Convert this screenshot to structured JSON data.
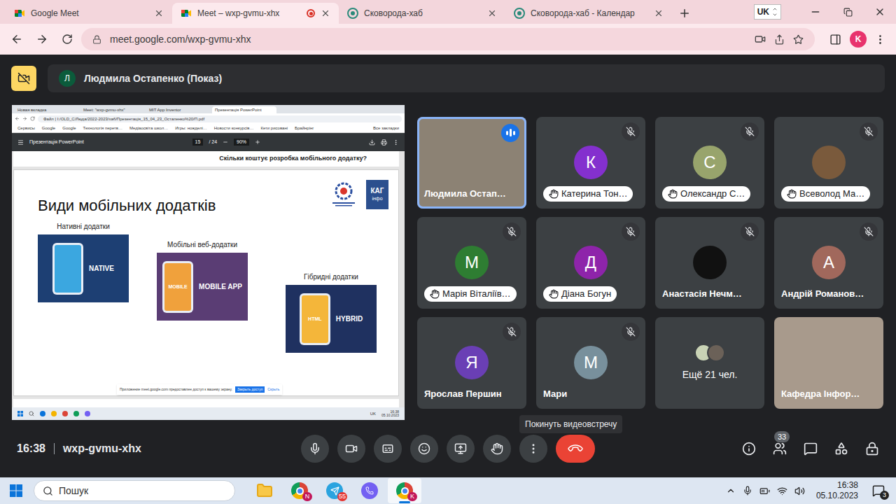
{
  "browser": {
    "tabs": [
      {
        "label": "Google Meet",
        "selected": false,
        "recording": false,
        "kind": "meet"
      },
      {
        "label": "Meet – wxp-gvmu-xhx",
        "selected": true,
        "recording": true,
        "kind": "meet"
      },
      {
        "label": "Сковорода-хаб",
        "selected": false,
        "recording": false,
        "kind": "hub"
      },
      {
        "label": "Сковорода-хаб - Календар",
        "selected": false,
        "recording": false,
        "kind": "hub"
      }
    ],
    "language": "UK",
    "url": "meet.google.com/wxp-gvmu-xhx",
    "profile": "K"
  },
  "meet": {
    "presenter": {
      "initial": "Л",
      "label": "Людмила Остапенко (Показ)"
    },
    "screen": {
      "tabs": [
        {
          "label": "Новая вкладка",
          "selected": false
        },
        {
          "label": "Meet: \"wxp-gvmu-xhx\"",
          "selected": false
        },
        {
          "label": "MIT App Inventor",
          "selected": false
        },
        {
          "label": "Презентація PowerPoint",
          "selected": true
        }
      ],
      "url": "Файл | I:/OLD_C/Люда/2022-2023/хаб/Презентація_15_04_23_Остапенко%20/П.pdf",
      "bookmarks": [
        "Сервисы",
        "Google",
        "Google",
        "Технологія перетв…",
        "Медіаосвіта школ…",
        "Игры: ножделі…",
        "Новости конкурсів…",
        "Кети рисовані",
        "Брайнрінг"
      ],
      "all_bookmarks": "Все закладки",
      "pdf_title": "Презентація PowerPoint",
      "page": "15",
      "pages": "/ 24",
      "zoom": "90%",
      "prev_heading": "Скільки коштує розробка мобільного додатку?",
      "slide_title": "Види мобільних додатків",
      "logo": "КАГ",
      "logo_sub": "інфо",
      "app_types": [
        {
          "label": "Нативні додатки",
          "badge": "NATIVE",
          "screen_text": "",
          "color": "#1d3f73"
        },
        {
          "label": "Мобільні веб-додатки",
          "badge": "MOBILE APP",
          "screen_text": "MOBILE",
          "color": "#5a3d74"
        },
        {
          "label": "Гібридні додатки",
          "badge": "HYBRID",
          "screen_text": "HTML",
          "color": "#1f3160"
        }
      ],
      "banner": {
        "text": "Приложение meet.google.com предоставлен доступ к вашему экрану.",
        "button": "Закрыть доступ",
        "link": "Скрыть"
      },
      "taskbar": {
        "lang": "UK",
        "time": "16:38",
        "date": "05.10.2023"
      }
    },
    "participants": [
      {
        "kind": "video",
        "name": "Людмила Остап…",
        "initial": "",
        "color": "#8c8274",
        "muted": false,
        "hand_raised": false,
        "speaking": true
      },
      {
        "kind": "avatar",
        "name": "Катерина Тон…",
        "initial": "К",
        "color": "#8430ce",
        "muted": true,
        "hand_raised": true,
        "speaking": false
      },
      {
        "kind": "avatar",
        "name": "Олександр С…",
        "initial": "С",
        "color": "#98a46c",
        "muted": true,
        "hand_raised": true,
        "speaking": false
      },
      {
        "kind": "photo",
        "name": "Всеволод Ма…",
        "initial": "",
        "color": "#7a5a3c",
        "muted": true,
        "hand_raised": true,
        "speaking": false
      },
      {
        "kind": "avatar",
        "name": "Марія Віталіїв…",
        "initial": "М",
        "color": "#2e7d32",
        "muted": true,
        "hand_raised": true,
        "speaking": false
      },
      {
        "kind": "avatar",
        "name": "Діана Богун",
        "initial": "Д",
        "color": "#8e24aa",
        "muted": true,
        "hand_raised": true,
        "speaking": false
      },
      {
        "kind": "photo",
        "name": "Анастасія Нечм…",
        "initial": "",
        "color": "#111111",
        "muted": true,
        "hand_raised": false,
        "speaking": false
      },
      {
        "kind": "avatar",
        "name": "Андрій Романов…",
        "initial": "А",
        "color": "#a1685c",
        "muted": true,
        "hand_raised": false,
        "speaking": false
      },
      {
        "kind": "avatar",
        "name": "Ярослав Першин",
        "initial": "Я",
        "color": "#6a3fb5",
        "muted": true,
        "hand_raised": false,
        "speaking": false
      },
      {
        "kind": "avatar",
        "name": "Мари",
        "initial": "М",
        "color": "#78909c",
        "muted": true,
        "hand_raised": false,
        "speaking": false
      },
      {
        "kind": "more",
        "name": "Ещё 21 чел.",
        "initial": "",
        "color": "#3c4043",
        "muted": false,
        "hand_raised": false,
        "speaking": false
      },
      {
        "kind": "video",
        "name": "Кафедра Інфор…",
        "initial": "",
        "color": "#a89a8c",
        "muted": false,
        "hand_raised": false,
        "speaking": false
      }
    ],
    "tooltip": "Покинуть видеовстречу",
    "time": "16:38",
    "code": "wxp-gvmu-xhx",
    "people_count": "33"
  },
  "taskbar": {
    "search": "Пошук",
    "apps": [
      {
        "kind": "explorer",
        "badge": "",
        "selected": false
      },
      {
        "kind": "chrome",
        "badge": "N",
        "selected": false
      },
      {
        "kind": "telegram",
        "badge": "55",
        "selected": false
      },
      {
        "kind": "viber",
        "badge": "",
        "selected": false
      },
      {
        "kind": "chrome",
        "badge": "K",
        "selected": true
      }
    ],
    "time": "16:38",
    "date": "05.10.2023",
    "notifications": "3"
  }
}
